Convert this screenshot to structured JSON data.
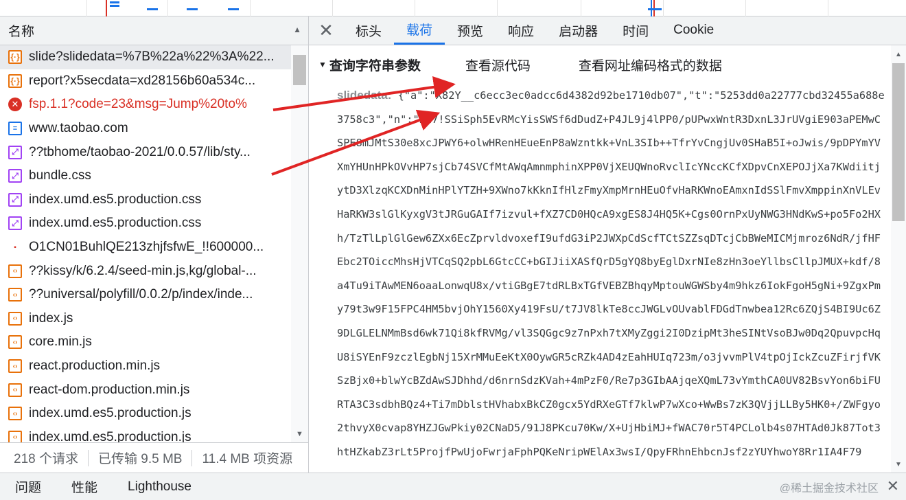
{
  "list": {
    "header_label": "名称",
    "requests": [
      {
        "icon": "xhr",
        "name": "slide?slidedata=%7B%22a%22%3A%22...",
        "selected": true
      },
      {
        "icon": "xhr",
        "name": "report?x5secdata=xd28156b60a534c..."
      },
      {
        "icon": "err",
        "name": "fsp.1.1?code=23&msg=Jump%20to%",
        "error": true
      },
      {
        "icon": "doc",
        "name": "www.taobao.com"
      },
      {
        "icon": "css",
        "name": "??tbhome/taobao-2021/0.0.57/lib/sty..."
      },
      {
        "icon": "css",
        "name": "bundle.css"
      },
      {
        "icon": "css",
        "name": "index.umd.es5.production.css"
      },
      {
        "icon": "css",
        "name": "index.umd.es5.production.css"
      },
      {
        "icon": "img",
        "name": "O1CN01BuhlQE213zhjfsfwE_!!600000..."
      },
      {
        "icon": "js",
        "name": "??kissy/k/6.2.4/seed-min.js,kg/global-..."
      },
      {
        "icon": "js",
        "name": "??universal/polyfill/0.0.2/p/index/inde..."
      },
      {
        "icon": "js",
        "name": "index.js"
      },
      {
        "icon": "js",
        "name": "core.min.js"
      },
      {
        "icon": "js",
        "name": "react.production.min.js"
      },
      {
        "icon": "js",
        "name": "react-dom.production.min.js"
      },
      {
        "icon": "js",
        "name": "index.umd.es5.production.js"
      },
      {
        "icon": "js",
        "name": "index.umd.es5.production.js"
      }
    ]
  },
  "status": {
    "requests": "218 个请求",
    "transferred": "已传输 9.5 MB",
    "resources": "11.4 MB 项资源"
  },
  "tabs": [
    "标头",
    "载荷",
    "预览",
    "响应",
    "启动器",
    "时间",
    "Cookie"
  ],
  "active_tab": "载荷",
  "payload": {
    "section_title": "查询字符串参数",
    "view_source": "查看源代码",
    "view_url_encoded": "查看网址编码格式的数据",
    "param_key": "slidedata:",
    "param_value": "{\"a\":\"X82Y__c6ecc3ec0adcc6d4382d92be1710db07\",\"t\":\"5253dd0a22777cbd32455a688e3758c3\",\"n\":\"227!SSiSph5EvRMcYisSWSf6dDudZ+P4JL9j4lPP0/pUPwxWntR3DxnL3JrUVgiE903aPEMwCSPE8mJMtS30e8xcJPWY6+olwHRenHEueEnP8aWzntkk+VnL3SIb++TfrYvCngjUv0SHaB5I+oJwis/9pDPYmYVXmYHUnHPkOVvHP7sjCb74SVCfMtAWqAmnmphinXPP0VjXEUQWnoRvclIcYNccKCfXDpvCnXEPOJjXa7KWdiitjytD3XlzqKCXDnMinHPlYTZH+9XWno7kKknIfHlzFmyXmpMrnHEuOfvHaRKWnoEAmxnIdSSlFmvXmppinXnVLEvHaRKW3slGlKyxgV3tJRGuGAIf7izvul+fXZ7CD0HQcA9xgES8J4HQ5K+Cgs0OrnPxUyNWG3HNdKwS+po5Fo2HXh/TzTlLplGlGew6ZXx6EcZprvldvoxefI9ufdG3iP2JWXpCdScfTCtSZZsqDTcjCbBWeMICMjmroz6NdR/jfHFEbc2TOiccMhsHjVTCqSQ2pbL6GtcCC+bGIJiiXASfQrD5gYQ8byEglDxrNIe8zHn3oeYllbsCllpJMUX+kdf/8a4Tu9iTAwMEN6oaaLonwqU8x/vtiGBgE7tdRLBxTGfVEBZBhqyMptouWGWSby4m9hkz6IokFgoH5gNi+9ZgxPmy79t3w9F15FPC4HM5bvjOhY1560Xy419FsU/t7JV8lkTe8ccJWGLvOUvablFDGdTnwbea12Rc6ZQjS4BI9Uc6Z9DLGLELNMmBsd6wk71Qi8kfRVMg/vl3SQGgc9z7nPxh7tXMyZggi2I0DzipMt3heSINtVsoBJw0Dq2QpuvpcHqU8iSYEnF9zczlEgbNj15XrMMuEeKtX0OywGR5cRZk4AD4zEahHUIq723m/o3jvvmPlV4tpOjIckZcuZFirjfVKSzBjx0+blwYcBZdAwSJDhhd/d6nrnSdzKVah+4mPzF0/Re7p3GIbAAjqeXQmL73vYmthCA0UV82BsvYon6biFURTA3C3sdbhBQz4+Ti7mDblstHVhabxBkCZ0gcx5YdRXeGTf7klwP7wXco+WwBs7zK3QVjjLLBy5HK0+/ZWFgyo2thvyX0cvap8YHZJGwPkiy02CNaD5/91J8PKcu70Kw/X+UjHbiMJ+fWAC70r5T4PCLolb4s07HTAd0Jk87Tot3htHZkabZ3rLt5ProjfPwUjoFwrjaFphPQKeNripWElAx3wsI/QpyFRhnEhbcnJsf2zYUYhwoY8Rr1IA4F79"
  },
  "drawer": {
    "tabs": [
      "问题",
      "性能",
      "Lighthouse"
    ],
    "watermark": "@稀土掘金技术社区"
  },
  "colors": {
    "accent": "#1a73e8",
    "error": "#d93025",
    "annotation": "#e02424"
  }
}
